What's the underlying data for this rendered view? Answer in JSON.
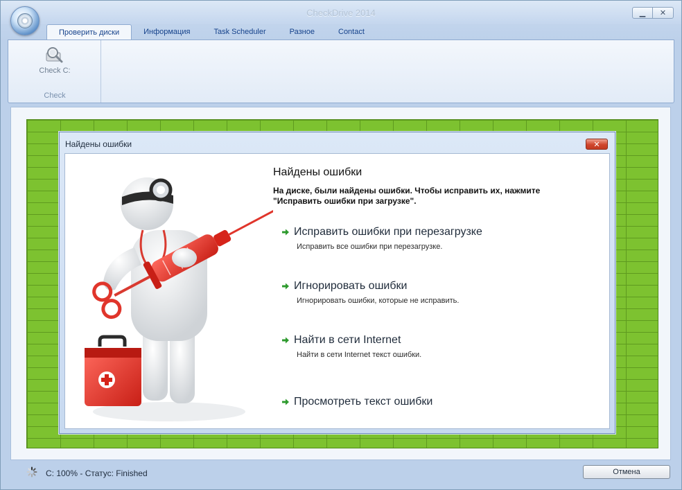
{
  "window": {
    "title": "CheckDrive 2014",
    "minimize_glyph": "▁",
    "close_glyph": "✕"
  },
  "tabs": [
    {
      "label": "Проверить диски",
      "active": true
    },
    {
      "label": "Информация"
    },
    {
      "label": "Task Scheduler"
    },
    {
      "label": "Разное"
    },
    {
      "label": "Contact"
    }
  ],
  "ribbon": {
    "check_button_label": "Check C:",
    "check_button_icon": "magnifier-disk-icon",
    "group_label": "Check"
  },
  "dialog": {
    "title": "Найдены ошибки",
    "close_glyph": "✕",
    "heading": "Найдены ошибки",
    "description": "На диске, были найдены ошибки. Чтобы исправить их, нажмите \"Исправить ошибки при загрузке\".",
    "illustration": "doctor-with-syringe-and-first-aid-kit",
    "actions": [
      {
        "label": "Исправить ошибки при перезагрузке",
        "description": "Исправить все ошибки при перезагрузке."
      },
      {
        "label": "Игнорировать ошибки",
        "description": "Игнорировать ошибки, которые не исправить."
      },
      {
        "label": "Найти в сети Internet",
        "description": "Найти в сети Internet текст ошибки."
      },
      {
        "label": "Просмотреть текст ошибки"
      }
    ]
  },
  "status": {
    "text": "C: 100% - Статус: Finished",
    "spinner_icon": "loading-spinner-icon"
  },
  "cancel_button": {
    "label": "Отмена"
  },
  "colors": {
    "brick_green": "#7dc230",
    "accent_arrow": "#2e9a2e",
    "dialog_close": "#d0462d"
  }
}
